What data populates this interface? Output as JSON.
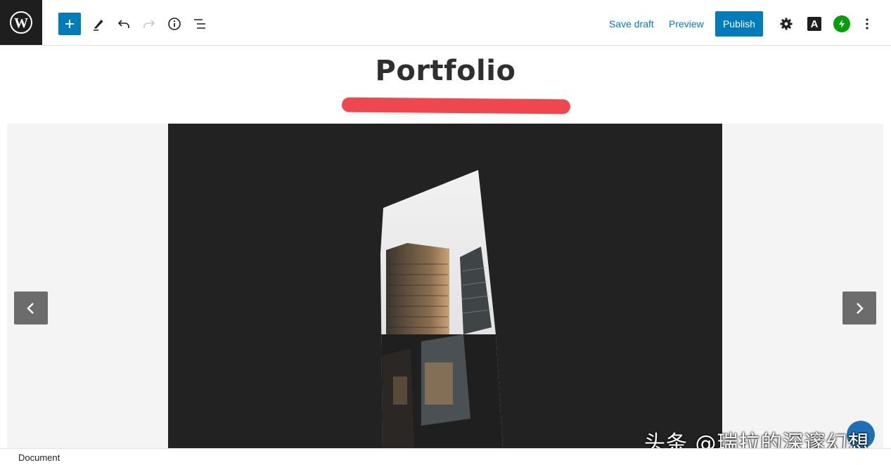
{
  "toolbar": {
    "add_block_icon": "plus-icon",
    "tools_icon": "pencil-icon",
    "undo_icon": "undo-icon",
    "redo_icon": "redo-icon",
    "details_icon": "info-icon",
    "list_view_icon": "list-view-icon",
    "save_draft_label": "Save draft",
    "preview_label": "Preview",
    "publish_label": "Publish",
    "settings_icon": "gear-icon",
    "typography_label": "A",
    "jetpack_icon": "jetpack-icon",
    "more_icon": "kebab-menu-icon"
  },
  "editor": {
    "title": "Portfolio"
  },
  "gallery": {
    "prev_icon": "chevron-left-icon",
    "next_icon": "chevron-right-icon"
  },
  "footer": {
    "breadcrumb": "Document"
  },
  "watermark": "头条 @瑞拉的深邃幻想",
  "colors": {
    "accent": "#007cba",
    "dark": "#1e1e1e",
    "redaction": "#f0474e",
    "jetpack": "#069e08"
  }
}
